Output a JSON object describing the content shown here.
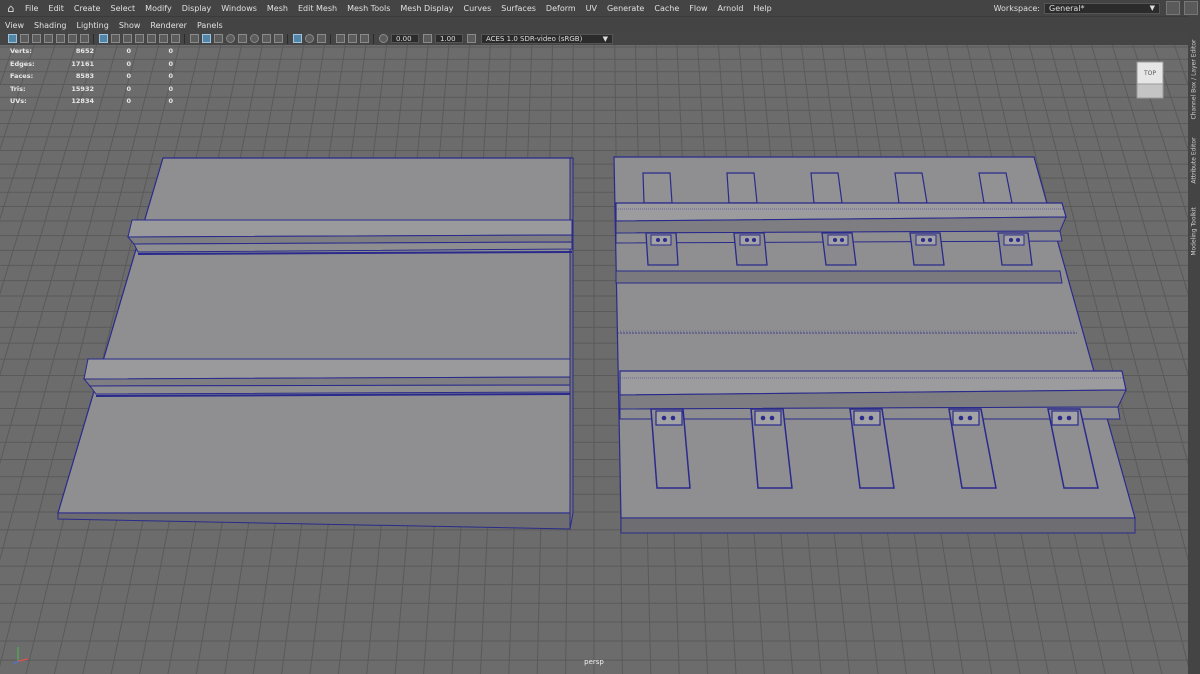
{
  "menubar": {
    "items": [
      "File",
      "Edit",
      "Create",
      "Select",
      "Modify",
      "Display",
      "Windows",
      "Mesh",
      "Edit Mesh",
      "Mesh Tools",
      "Mesh Display",
      "Curves",
      "Surfaces",
      "Deform",
      "UV",
      "Generate",
      "Cache",
      "Flow",
      "Arnold",
      "Help"
    ]
  },
  "workspace": {
    "label": "Workspace:",
    "value": "General*"
  },
  "panel_menu": {
    "items": [
      "View",
      "Shading",
      "Lighting",
      "Show",
      "Renderer",
      "Panels"
    ]
  },
  "toolbar": {
    "exposure": "0.00",
    "gamma": "1.00",
    "color_space": "ACES 1.0 SDR-video (sRGB)"
  },
  "hud": {
    "rows": [
      {
        "label": "Verts:",
        "value": "8652",
        "c1": "0",
        "c2": "0"
      },
      {
        "label": "Edges:",
        "value": "17161",
        "c1": "0",
        "c2": "0"
      },
      {
        "label": "Faces:",
        "value": "8583",
        "c1": "0",
        "c2": "0"
      },
      {
        "label": "Tris:",
        "value": "15932",
        "c1": "0",
        "c2": "0"
      },
      {
        "label": "UVs:",
        "value": "12834",
        "c1": "0",
        "c2": "0"
      }
    ]
  },
  "view_cube": {
    "face": "TOP"
  },
  "camera": {
    "name": "persp"
  },
  "right_tabs": [
    "Channel Box / Layer Editor",
    "Attribute Editor",
    "Modeling Toolkit"
  ],
  "colors": {
    "wire": "#2a2a8c",
    "mesh": "#8e8e90",
    "grid": "#5a5a5a",
    "accent": "#5285a6"
  }
}
